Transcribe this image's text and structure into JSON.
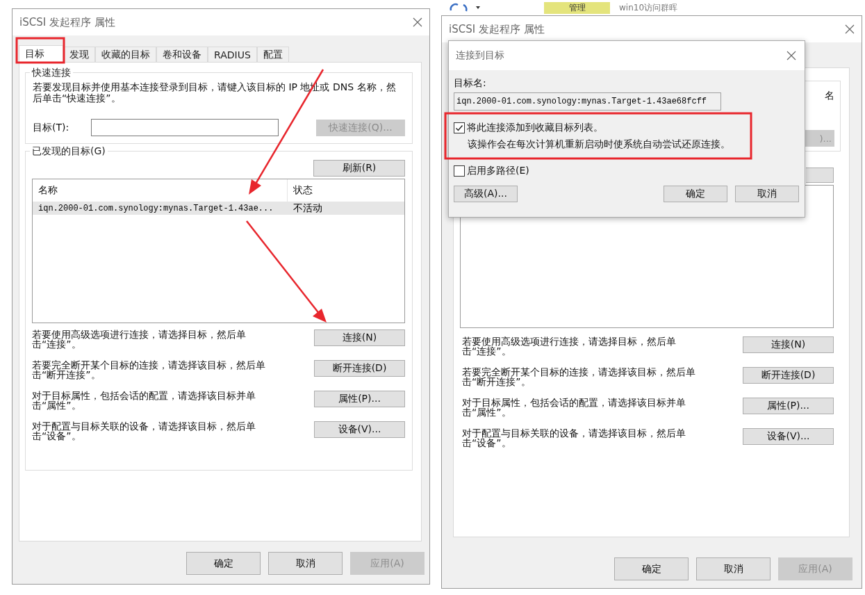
{
  "left_window": {
    "title": "iSCSI 发起程序 属性",
    "tabs": [
      {
        "label": "目标",
        "selected": true
      },
      {
        "label": "发现",
        "selected": false
      },
      {
        "label": "收藏的目标",
        "selected": false
      },
      {
        "label": "卷和设备",
        "selected": false
      },
      {
        "label": "RADIUS",
        "selected": false
      },
      {
        "label": "配置",
        "selected": false
      }
    ],
    "quick_connect": {
      "legend": "快速连接",
      "description": "若要发现目标并使用基本连接登录到目标，请键入该目标的 IP 地址或 DNS 名称，然后单击“快速连接”。",
      "target_label": "目标(T):",
      "button": {
        "label": "快速连接(Q)...",
        "disabled": true
      }
    },
    "discovered": {
      "legend": "已发现的目标(G)",
      "refresh_button": "刷新(R)",
      "columns": [
        "名称",
        "状态"
      ],
      "rows": [
        {
          "name": "iqn.2000-01.com.synology:mynas.Target-1.43ae...",
          "status": "不活动",
          "selected": true
        }
      ]
    },
    "actions": [
      {
        "text": "若要使用高级选项进行连接，请选择目标，然后单击“连接”。",
        "button": "连接(N)"
      },
      {
        "text": "若要完全断开某个目标的连接，请选择该目标，然后单击“断开连接”。",
        "button": "断开连接(D)"
      },
      {
        "text": "对于目标属性，包括会话的配置，请选择该目标并单击“属性”。",
        "button": "属性(P)..."
      },
      {
        "text": "对于配置与目标关联的设备，请选择该目标，然后单击“设备”。",
        "button": "设备(V)..."
      }
    ],
    "buttons": [
      {
        "label": "确定",
        "disabled": false
      },
      {
        "label": "取消",
        "disabled": false
      },
      {
        "label": "应用(A)",
        "disabled": true
      }
    ]
  },
  "right_window": {
    "explorer_strip": {
      "ribbon_tab": "管理",
      "folder_title": "win10访问群晖"
    },
    "title": "iSCSI 发起程序 属性",
    "background": {
      "description_fragment": "名",
      "button_fragment": ")...",
      "actions": [
        {
          "text": "若要使用高级选项进行连接，请选择目标，然后单击“连接”。",
          "button": "连接(N)"
        },
        {
          "text": "若要完全断开某个目标的连接，请选择该目标，然后单击“断开连接”。",
          "button": "断开连接(D)"
        },
        {
          "text": "对于目标属性，包括会话的配置，请选择该目标并单击“属性”。",
          "button": "属性(P)..."
        },
        {
          "text": "对于配置与目标关联的设备，请选择该目标，然后单击“设备”。",
          "button": "设备(V)..."
        }
      ],
      "buttons": [
        {
          "label": "确定",
          "disabled": false
        },
        {
          "label": "取消",
          "disabled": false
        },
        {
          "label": "应用(A)",
          "disabled": true
        }
      ]
    },
    "dialog": {
      "title": "连接到目标",
      "target_name_label": "目标名:",
      "target_name": "iqn.2000-01.com.synology:mynas.Target-1.43ae68fcff",
      "options": [
        {
          "label": "将此连接添加到收藏目标列表。",
          "note": "该操作会在每次计算机重新启动时使系统自动尝试还原连接。",
          "checked": true
        },
        {
          "label": "启用多路径(E)",
          "checked": false
        }
      ],
      "advanced_button": "高级(A)...",
      "buttons": [
        "确定",
        "取消"
      ]
    }
  }
}
